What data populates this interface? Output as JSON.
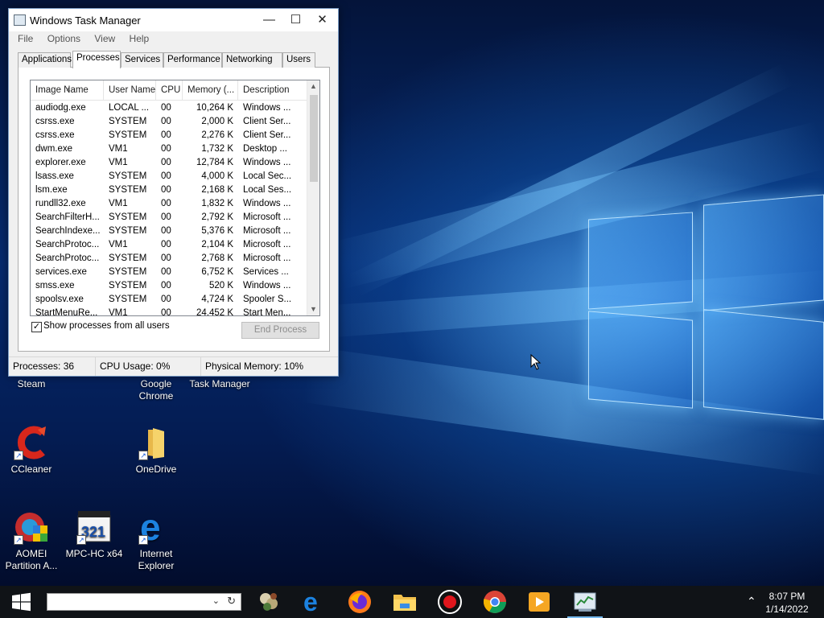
{
  "window": {
    "title": "Windows Task Manager",
    "minimize_glyph": "—",
    "maximize_glyph": "☐",
    "close_glyph": "✕",
    "menu": [
      "File",
      "Options",
      "View",
      "Help"
    ],
    "tabs": [
      "Applications",
      "Processes",
      "Services",
      "Performance",
      "Networking",
      "Users"
    ],
    "active_tab": "Processes",
    "columns": [
      "Image Name",
      "User Name",
      "CPU",
      "Memory (...",
      "Description"
    ],
    "processes": [
      {
        "name": "audiodg.exe",
        "user": "LOCAL ...",
        "cpu": "00",
        "mem": "10,264 K",
        "desc": "Windows ..."
      },
      {
        "name": "csrss.exe",
        "user": "SYSTEM",
        "cpu": "00",
        "mem": "2,000 K",
        "desc": "Client Ser..."
      },
      {
        "name": "csrss.exe",
        "user": "SYSTEM",
        "cpu": "00",
        "mem": "2,276 K",
        "desc": "Client Ser..."
      },
      {
        "name": "dwm.exe",
        "user": "VM1",
        "cpu": "00",
        "mem": "1,732 K",
        "desc": "Desktop ..."
      },
      {
        "name": "explorer.exe",
        "user": "VM1",
        "cpu": "00",
        "mem": "12,784 K",
        "desc": "Windows ..."
      },
      {
        "name": "lsass.exe",
        "user": "SYSTEM",
        "cpu": "00",
        "mem": "4,000 K",
        "desc": "Local Sec..."
      },
      {
        "name": "lsm.exe",
        "user": "SYSTEM",
        "cpu": "00",
        "mem": "2,168 K",
        "desc": "Local Ses..."
      },
      {
        "name": "rundll32.exe",
        "user": "VM1",
        "cpu": "00",
        "mem": "1,832 K",
        "desc": "Windows ..."
      },
      {
        "name": "SearchFilterH...",
        "user": "SYSTEM",
        "cpu": "00",
        "mem": "2,792 K",
        "desc": "Microsoft ..."
      },
      {
        "name": "SearchIndexe...",
        "user": "SYSTEM",
        "cpu": "00",
        "mem": "5,376 K",
        "desc": "Microsoft ..."
      },
      {
        "name": "SearchProtoc...",
        "user": "VM1",
        "cpu": "00",
        "mem": "2,104 K",
        "desc": "Microsoft ..."
      },
      {
        "name": "SearchProtoc...",
        "user": "SYSTEM",
        "cpu": "00",
        "mem": "2,768 K",
        "desc": "Microsoft ..."
      },
      {
        "name": "services.exe",
        "user": "SYSTEM",
        "cpu": "00",
        "mem": "6,752 K",
        "desc": "Services ..."
      },
      {
        "name": "smss.exe",
        "user": "SYSTEM",
        "cpu": "00",
        "mem": "520 K",
        "desc": "Windows ..."
      },
      {
        "name": "spoolsv.exe",
        "user": "SYSTEM",
        "cpu": "00",
        "mem": "4,724 K",
        "desc": "Spooler S..."
      },
      {
        "name": "StartMenuRe...",
        "user": "VM1",
        "cpu": "00",
        "mem": "24,452 K",
        "desc": "Start Men..."
      }
    ],
    "show_all_label": "Show processes from all users",
    "show_all_checked": true,
    "end_process_label": "End Process",
    "status": {
      "processes": "Processes: 36",
      "cpu": "CPU Usage: 0%",
      "memory": "Physical Memory: 10%"
    }
  },
  "desktop_icons": [
    {
      "label": "Steam",
      "icon": "steam-icon"
    },
    {
      "label": "Google Chrome",
      "icon": "chrome-icon"
    },
    {
      "label": "Task Manager",
      "icon": "task-manager-icon"
    },
    {
      "label": "CCleaner",
      "icon": "ccleaner-icon"
    },
    {
      "label": "OneDrive",
      "icon": "folder-icon"
    },
    {
      "label": "AOMEI Partition A...",
      "icon": "aomei-icon"
    },
    {
      "label": "MPC-HC x64",
      "icon": "mpc-hc-icon"
    },
    {
      "label": "Internet Explorer",
      "icon": "edge-icon"
    }
  ],
  "taskbar": {
    "search_value": "",
    "apps": [
      "game-icon",
      "edge-icon",
      "firefox-icon",
      "file-explorer-icon",
      "record-icon",
      "chrome-icon",
      "media-player-icon",
      "task-manager-icon"
    ],
    "active_app": "task-manager-icon",
    "time": "8:07 PM",
    "date": "1/14/2022"
  },
  "colors": {
    "accent": "#76b9ed",
    "wallpaper": "#062a6e",
    "taskbar": "#101317"
  }
}
